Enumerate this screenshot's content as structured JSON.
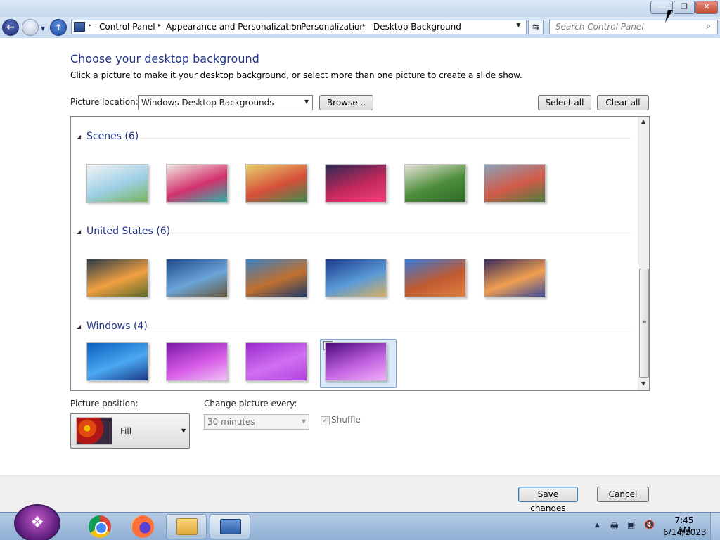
{
  "window": {
    "minimize_label": "—",
    "maximize_label": "❐",
    "close_label": "✕"
  },
  "nav": {
    "back_glyph": "←",
    "up_glyph": "↑",
    "history_glyph": "▼"
  },
  "address": {
    "crumbs": [
      "Control Panel",
      "Appearance and Personalization",
      "Personalization",
      "Desktop Background"
    ],
    "sep": "▸",
    "dd": "▼",
    "refresh": "⇆"
  },
  "search": {
    "placeholder": "Search Control Panel",
    "icon": "⌕"
  },
  "page": {
    "title": "Choose your desktop background",
    "description": "Click a picture to make it your desktop background, or select more than one picture to create a slide show.",
    "location_label": "Picture location:",
    "location_value": "Windows Desktop Backgrounds",
    "browse_label": "Browse...",
    "select_all_label": "Select all",
    "clear_all_label": "Clear all"
  },
  "gallery": {
    "groups": [
      {
        "title": "Scenes (6)",
        "thumbs": [
          {
            "name": "thumb-scenes-1",
            "colors": [
              "#f4f4f4",
              "#9ccfe6",
              "#79b55a"
            ]
          },
          {
            "name": "thumb-scenes-2",
            "colors": [
              "#f1e9e0",
              "#d2326e",
              "#2bb5a8"
            ]
          },
          {
            "name": "thumb-scenes-3",
            "colors": [
              "#e8d26c",
              "#d64f3a",
              "#3b8b4b"
            ]
          },
          {
            "name": "thumb-scenes-4",
            "colors": [
              "#2a2a55",
              "#c2285b",
              "#f0417a"
            ]
          },
          {
            "name": "thumb-scenes-5",
            "colors": [
              "#e9e4dc",
              "#4d8d3a",
              "#2f6a2a"
            ]
          },
          {
            "name": "thumb-scenes-6",
            "colors": [
              "#8aa3b8",
              "#d25a4a",
              "#4a7c3a"
            ]
          }
        ]
      },
      {
        "title": "United States (6)",
        "thumbs": [
          {
            "name": "thumb-us-1",
            "colors": [
              "#2a3a4a",
              "#f0a040",
              "#5d6a2a"
            ]
          },
          {
            "name": "thumb-us-2",
            "colors": [
              "#1e4a8a",
              "#6aa4d8",
              "#6a5a3a"
            ]
          },
          {
            "name": "thumb-us-3",
            "colors": [
              "#3a7fc0",
              "#c07030",
              "#1a3a6a"
            ]
          },
          {
            "name": "thumb-us-4",
            "colors": [
              "#1a3a8a",
              "#5a9ad8",
              "#d8b060"
            ]
          },
          {
            "name": "thumb-us-5",
            "colors": [
              "#3a7ad8",
              "#c05a30",
              "#e08040"
            ]
          },
          {
            "name": "thumb-us-6",
            "colors": [
              "#3a2a5a",
              "#f0a050",
              "#3a4a9a"
            ]
          }
        ]
      },
      {
        "title": "Windows (4)",
        "thumbs": [
          {
            "name": "thumb-windows-1",
            "colors": [
              "#0a5fbf",
              "#4aa8f0",
              "#1a3a8a"
            ]
          },
          {
            "name": "thumb-windows-2",
            "colors": [
              "#7a1aa8",
              "#d65ae6",
              "#f0c0f8"
            ]
          },
          {
            "name": "thumb-windows-3",
            "colors": [
              "#9a2ad0",
              "#d070f0",
              "#b040e0"
            ]
          },
          {
            "name": "thumb-windows-4",
            "colors": [
              "#4a0a7a",
              "#c060e0",
              "#f0b0f8"
            ]
          }
        ]
      }
    ],
    "group_triangle": "◢",
    "selected_check": "✓",
    "scroll_up": "▲",
    "scroll_down": "▼",
    "scroll_grip": "≡"
  },
  "position": {
    "label": "Picture position:",
    "value": "Fill",
    "arrow": "▼"
  },
  "change": {
    "label": "Change picture every:",
    "value": "30 minutes",
    "arrow": "▼",
    "shuffle_label": "Shuffle",
    "shuffle_check": "✓"
  },
  "footer": {
    "save_label": "Save changes",
    "cancel_label": "Cancel"
  },
  "taskbar": {
    "start_glyph": "❖",
    "tray_icons": [
      "▲",
      "🖶",
      "▣",
      "🔇"
    ],
    "time": "7:45 AM",
    "date": "6/14/2023"
  }
}
